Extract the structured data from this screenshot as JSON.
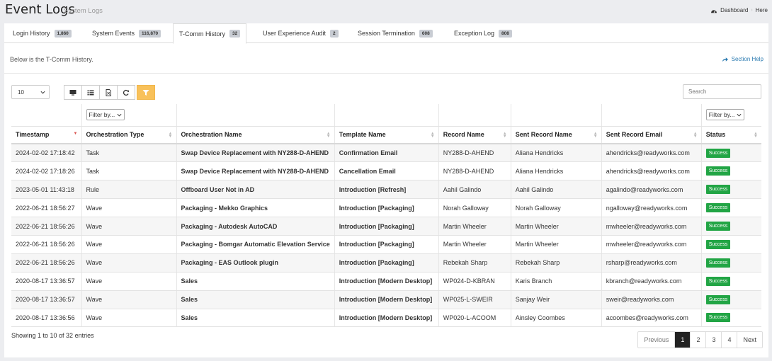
{
  "header": {
    "title": "Event Logs",
    "subtitle": "System Logs",
    "breadcrumbs": [
      "Dashboard",
      "Here"
    ]
  },
  "tabs": [
    {
      "label": "Login History",
      "count": "1,860"
    },
    {
      "label": "System Events",
      "count": "116,870"
    },
    {
      "label": "T-Comm History",
      "count": "32"
    },
    {
      "label": "User Experience Audit",
      "count": "2"
    },
    {
      "label": "Session Termination",
      "count": "608"
    },
    {
      "label": "Exception Log",
      "count": "808"
    }
  ],
  "intro_text": "Below is the T-Comm History.",
  "section_help": "Section Help",
  "toolbar": {
    "page_length": "10",
    "icons": [
      "monitor-icon",
      "list-icon",
      "export-file-icon",
      "refresh-icon",
      "filter-icon"
    ],
    "search_placeholder": "Search"
  },
  "filters": {
    "orchestration_type": "Filter by...",
    "status": "Filter by..."
  },
  "columns": [
    "Timestamp",
    "Orchestration Type",
    "Orchestration Name",
    "Template Name",
    "Record Name",
    "Sent Record Name",
    "Sent Record Email",
    "Status"
  ],
  "rows": [
    [
      "2024-02-02 17:18:42",
      "Task",
      "Swap Device Replacement with NY288-D-AHEND",
      "Confirmation Email",
      "NY288-D-AHEND",
      "Aliana Hendricks",
      "ahendricks@readyworks.com",
      "Success"
    ],
    [
      "2024-02-02 17:18:26",
      "Task",
      "Swap Device Replacement with NY288-D-AHEND",
      "Cancellation Email",
      "NY288-D-AHEND",
      "Aliana Hendricks",
      "ahendricks@readyworks.com",
      "Success"
    ],
    [
      "2023-05-01 11:43:18",
      "Rule",
      "Offboard User Not in AD",
      "Introduction [Refresh]",
      "Aahil Galindo",
      "Aahil Galindo",
      "agalindo@readyworks.com",
      "Success"
    ],
    [
      "2022-06-21 18:56:27",
      "Wave",
      "Packaging - Mekko Graphics",
      "Introduction [Packaging]",
      "Norah Galloway",
      "Norah Galloway",
      "ngalloway@readyworks.com",
      "Success"
    ],
    [
      "2022-06-21 18:56:26",
      "Wave",
      "Packaging - Autodesk AutoCAD",
      "Introduction [Packaging]",
      "Martin Wheeler",
      "Martin Wheeler",
      "mwheeler@readyworks.com",
      "Success"
    ],
    [
      "2022-06-21 18:56:26",
      "Wave",
      "Packaging - Bomgar Automatic Elevation Service",
      "Introduction [Packaging]",
      "Martin Wheeler",
      "Martin Wheeler",
      "mwheeler@readyworks.com",
      "Success"
    ],
    [
      "2022-06-21 18:56:26",
      "Wave",
      "Packaging - EAS Outlook plugin",
      "Introduction [Packaging]",
      "Rebekah Sharp",
      "Rebekah Sharp",
      "rsharp@readyworks.com",
      "Success"
    ],
    [
      "2020-08-17 13:36:57",
      "Wave",
      "Sales",
      "Introduction [Modern Desktop]",
      "WP024-D-KBRAN",
      "Karis Branch",
      "kbranch@readyworks.com",
      "Success"
    ],
    [
      "2020-08-17 13:36:57",
      "Wave",
      "Sales",
      "Introduction [Modern Desktop]",
      "WP025-L-SWEIR",
      "Sanjay Weir",
      "sweir@readyworks.com",
      "Success"
    ],
    [
      "2020-08-17 13:36:56",
      "Wave",
      "Sales",
      "Introduction [Modern Desktop]",
      "WP020-L-ACOOM",
      "Ainsley Coombes",
      "acoombes@readyworks.com",
      "Success"
    ]
  ],
  "info_text": "Showing 1 to 10 of 32 entries",
  "pagination": {
    "previous": "Previous",
    "pages": [
      "1",
      "2",
      "3",
      "4"
    ],
    "next": "Next"
  },
  "colors": {
    "success": "#22a545",
    "filter_button": "#f8c15a",
    "link": "#2a7ab0"
  }
}
